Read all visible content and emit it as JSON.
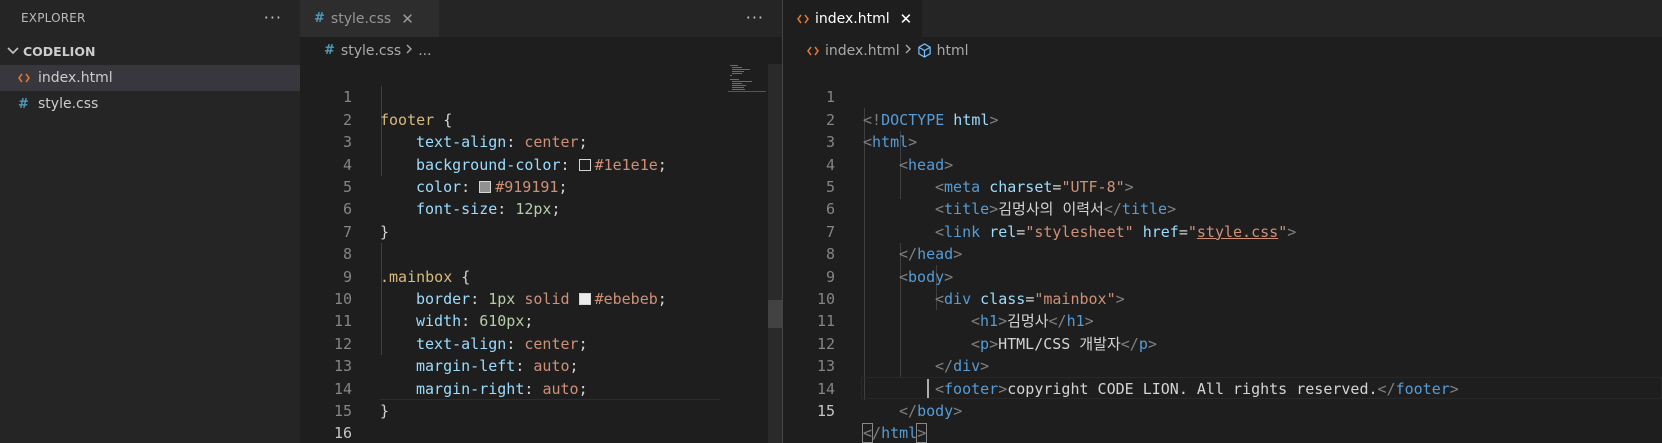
{
  "sidebar": {
    "title": "EXPLORER",
    "more": "···",
    "folder": "CODELION",
    "files": [
      {
        "name": "index.html",
        "icon": "html-file-icon",
        "active": true
      },
      {
        "name": "style.css",
        "icon": "css-file-icon",
        "active": false
      }
    ]
  },
  "left_editor": {
    "tab": {
      "label": "style.css",
      "icon_glyph": "#",
      "close": "✕"
    },
    "actions": "···",
    "breadcrumb": {
      "file": "style.css",
      "rest": "..."
    },
    "line_numbers": [
      "1",
      "2",
      "3",
      "4",
      "5",
      "6",
      "7",
      "8",
      "9",
      "10",
      "11",
      "12",
      "13",
      "14",
      "15",
      "16"
    ],
    "code": {
      "l1_sel": "footer",
      "l1_brace": " {",
      "l2_prop": "text-align",
      "l2_val": "center",
      "l3_prop": "background-color",
      "l3_val": "#1e1e1e",
      "l3_swatch": "#1e1e1e",
      "l4_prop": "color",
      "l4_val": "#919191",
      "l4_swatch": "#919191",
      "l5_prop": "font-size",
      "l5_val": "12px",
      "l6": "}",
      "l8_sel": ".mainbox",
      "l8_brace": " {",
      "l9_prop": "border",
      "l9_num": "1px",
      "l9_kw": "solid",
      "l9_val": "#ebebeb",
      "l9_swatch": "#ebebeb",
      "l10_prop": "width",
      "l10_val": "610px",
      "l11_prop": "text-align",
      "l11_val": "center",
      "l12_prop": "margin-left",
      "l12_val": "auto",
      "l13_prop": "margin-right",
      "l13_val": "auto",
      "l14": "}",
      "colon": ": ",
      "semi": ";"
    }
  },
  "right_editor": {
    "tab": {
      "label": "index.html",
      "icon_glyph": "<>",
      "close": "✕"
    },
    "breadcrumb": {
      "file": "index.html",
      "symbol": "html"
    },
    "line_numbers": [
      "1",
      "2",
      "3",
      "4",
      "5",
      "6",
      "7",
      "8",
      "9",
      "10",
      "11",
      "12",
      "13",
      "14",
      "15"
    ],
    "code": {
      "doctype_open": "<!",
      "doctype": "DOCTYPE",
      "doctype_html": " html",
      "doctype_close": ">",
      "html": "html",
      "head": "head",
      "meta": "meta",
      "charset_attr": "charset",
      "charset_val": "\"UTF-8\"",
      "title": "title",
      "title_text": "김멍사의 이력서",
      "link": "link",
      "rel_attr": "rel",
      "rel_val": "\"stylesheet\"",
      "href_attr": "href",
      "href_q": "\"",
      "href_val": "style.css",
      "body": "body",
      "div": "div",
      "class_attr": "class",
      "class_val": "\"mainbox\"",
      "h1": "h1",
      "h1_text": "김멍사",
      "p": "p",
      "p_text": "HTML/CSS 개발자",
      "footer": "footer",
      "footer_text": "copyright CODE LION. All rights reserved."
    }
  }
}
